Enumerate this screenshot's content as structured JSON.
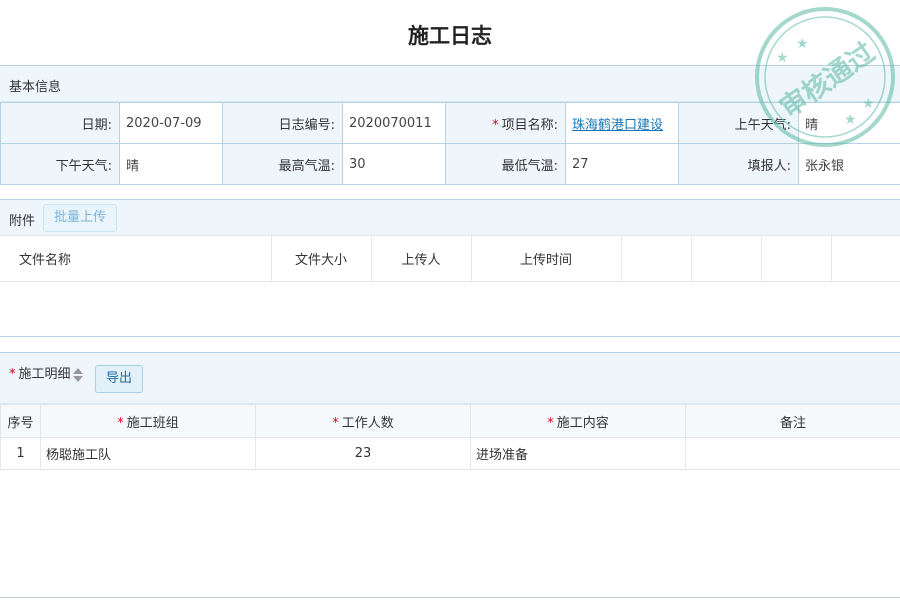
{
  "page": {
    "title": "施工日志"
  },
  "basic_info": {
    "section_label": "基本信息",
    "rows": [
      [
        {
          "label": "日期:",
          "value": "2020-07-09"
        },
        {
          "label": "日志编号:",
          "value": "2020070011"
        },
        {
          "label": "项目名称:",
          "value": "珠海鹤港口建设",
          "required": true
        },
        {
          "label": "上午天气:",
          "value": "晴"
        }
      ],
      [
        {
          "label": "下午天气:",
          "value": "晴"
        },
        {
          "label": "最高气温:",
          "value": "30"
        },
        {
          "label": "最低气温:",
          "value": "27"
        },
        {
          "label": "填报人:",
          "value": "张永银"
        }
      ]
    ]
  },
  "attachments": {
    "section_label": "附件",
    "upload_button": "批量上传",
    "columns": [
      "文件名称",
      "文件大小",
      "上传人",
      "上传时间",
      "",
      "",
      "",
      ""
    ]
  },
  "detail": {
    "section_label": "施工明细",
    "export_button": "导出",
    "columns": [
      "序号",
      "施工班组",
      "工作人数",
      "施工内容",
      "备注"
    ],
    "rows": [
      {
        "index": "1",
        "team": "杨聪施工队",
        "workers": "23",
        "content": "进场准备",
        "remark": ""
      }
    ]
  },
  "stamp": {
    "text": "审核通过",
    "color": "#5ab9a5"
  }
}
